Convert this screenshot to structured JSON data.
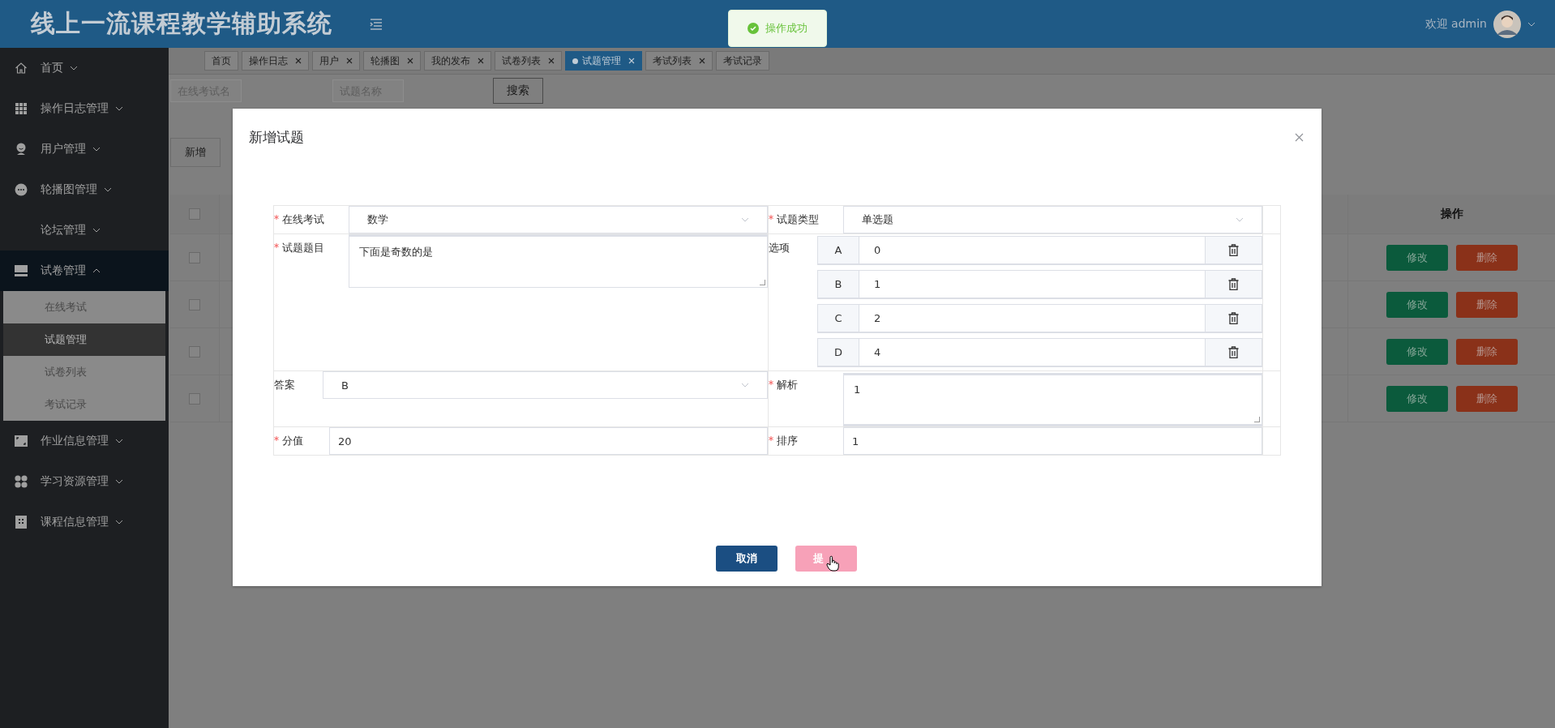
{
  "header": {
    "title": "线上一流课程教学辅助系统",
    "welcome": "欢迎 admin"
  },
  "toast": {
    "text": "操作成功"
  },
  "sidebar": {
    "items": [
      {
        "label": "首页",
        "expanded": false
      },
      {
        "label": "操作日志管理",
        "expanded": false
      },
      {
        "label": "用户管理",
        "expanded": false
      },
      {
        "label": "轮播图管理",
        "expanded": false
      },
      {
        "label": "论坛管理",
        "expanded": false
      },
      {
        "label": "试卷管理",
        "expanded": true,
        "children": [
          {
            "label": "在线考试",
            "selected": false
          },
          {
            "label": "试题管理",
            "selected": true
          },
          {
            "label": "试卷列表",
            "selected": false
          },
          {
            "label": "考试记录",
            "selected": false
          }
        ]
      },
      {
        "label": "作业信息管理",
        "expanded": false
      },
      {
        "label": "学习资源管理",
        "expanded": false
      },
      {
        "label": "课程信息管理",
        "expanded": false
      }
    ]
  },
  "tabs": [
    {
      "label": "首页",
      "closable": false,
      "selected": false
    },
    {
      "label": "操作日志",
      "closable": true,
      "selected": false
    },
    {
      "label": "用户",
      "closable": true,
      "selected": false
    },
    {
      "label": "轮播图",
      "closable": true,
      "selected": false
    },
    {
      "label": "我的发布",
      "closable": true,
      "selected": false
    },
    {
      "label": "试卷列表",
      "closable": true,
      "selected": false
    },
    {
      "label": "试题管理",
      "closable": true,
      "selected": true
    },
    {
      "label": "考试列表",
      "closable": true,
      "selected": false
    },
    {
      "label": "考试记录",
      "closable": false,
      "selected": false
    }
  ],
  "search": {
    "fields": [
      {
        "placeholder": "在线考试名"
      },
      {
        "placeholder": "试题名称"
      }
    ],
    "button": "搜索"
  },
  "toolbar": {
    "add_button": "新增"
  },
  "table": {
    "header_checked": false,
    "action_header": "操作",
    "rows": [
      {
        "checked": false,
        "actions": [
          "修改",
          "删除"
        ]
      },
      {
        "checked": false,
        "actions": [
          "修改",
          "删除"
        ]
      },
      {
        "checked": false,
        "actions": [
          "修改",
          "删除"
        ]
      },
      {
        "checked": false,
        "actions": [
          "修改",
          "删除"
        ]
      }
    ]
  },
  "dialog": {
    "title": "新增试题",
    "exam": {
      "label": "在线考试",
      "required": true,
      "value": "数学"
    },
    "type": {
      "label": "试题类型",
      "required": true,
      "value": "单选题"
    },
    "question": {
      "label": "试题题目",
      "required": true,
      "value": "下面是奇数的是"
    },
    "options_label": "选项",
    "options": [
      {
        "letter": "A",
        "value": "0"
      },
      {
        "letter": "B",
        "value": "1"
      },
      {
        "letter": "C",
        "value": "2"
      },
      {
        "letter": "D",
        "value": "4"
      }
    ],
    "answer": {
      "label": "答案",
      "required": false,
      "value": "B"
    },
    "analysis": {
      "label": "解析",
      "required": true,
      "value": "1"
    },
    "score": {
      "label": "分值",
      "required": true,
      "value": "20"
    },
    "order": {
      "label": "排序",
      "required": true,
      "value": "1"
    },
    "cancel_button": "取消",
    "submit_button": "提"
  }
}
